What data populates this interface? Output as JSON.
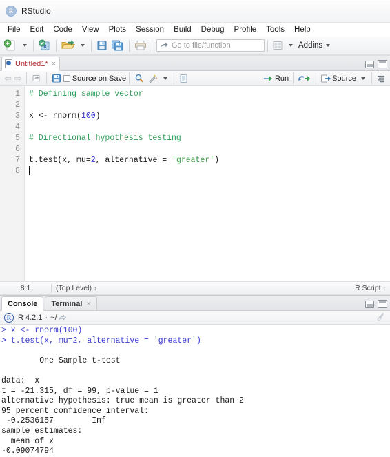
{
  "window": {
    "app_title": "RStudio",
    "logo_letter": "R"
  },
  "menubar": {
    "items": [
      {
        "label": "File"
      },
      {
        "label": "Edit"
      },
      {
        "label": "Code"
      },
      {
        "label": "View"
      },
      {
        "label": "Plots"
      },
      {
        "label": "Session"
      },
      {
        "label": "Build"
      },
      {
        "label": "Debug"
      },
      {
        "label": "Profile"
      },
      {
        "label": "Tools"
      },
      {
        "label": "Help"
      }
    ]
  },
  "toolbar": {
    "new_file_tooltip": "New File",
    "new_project_tooltip": "New Project",
    "open_file_tooltip": "Open File",
    "save_tooltip": "Save",
    "save_all_tooltip": "Save All",
    "print_tooltip": "Print",
    "goto_placeholder": "Go to file/function",
    "workspace_panes_tooltip": "Workspace Panes",
    "addins_label": "Addins"
  },
  "source_pane": {
    "tab": {
      "title": "Untitled1*",
      "close_label": "×"
    },
    "toolbar": {
      "back_label": "⇦",
      "forward_label": "⇨",
      "popout_tooltip": "Show in new window",
      "save_tooltip": "Save current document",
      "source_on_save_label": "Source on Save",
      "find_tooltip": "Find/Replace",
      "magic_tooltip": "Code Tools",
      "compile_report_tooltip": "Compile Report",
      "run_label": "Run",
      "rerun_tooltip": "Re-run previous code region",
      "source_label": "Source",
      "outline_tooltip": "Show document outline"
    },
    "code": {
      "line_numbers": [
        "1",
        "2",
        "3",
        "4",
        "5",
        "6",
        "7",
        "8"
      ],
      "lines": [
        {
          "n": 1,
          "tokens": [
            {
              "t": "# Defining sample vector",
              "c": "comment"
            }
          ]
        },
        {
          "n": 2,
          "tokens": []
        },
        {
          "n": 3,
          "tokens": [
            {
              "t": "x <- rnorm(",
              "c": "plain"
            },
            {
              "t": "100",
              "c": "num"
            },
            {
              "t": ")",
              "c": "plain"
            }
          ]
        },
        {
          "n": 4,
          "tokens": []
        },
        {
          "n": 5,
          "tokens": [
            {
              "t": "# Directional hypothesis testing",
              "c": "comment"
            }
          ]
        },
        {
          "n": 6,
          "tokens": []
        },
        {
          "n": 7,
          "tokens": [
            {
              "t": "t.test(x, mu=",
              "c": "plain"
            },
            {
              "t": "2",
              "c": "num"
            },
            {
              "t": ", alternative = ",
              "c": "plain"
            },
            {
              "t": "'greater'",
              "c": "str"
            },
            {
              "t": ")",
              "c": "plain"
            }
          ]
        },
        {
          "n": 8,
          "tokens": [],
          "caret": true
        }
      ]
    },
    "status": {
      "cursor_position": "8:1",
      "scope": "(Top Level)",
      "file_type": "R Script"
    }
  },
  "console_pane": {
    "tabs": [
      {
        "label": "Console",
        "active": true,
        "closable": false
      },
      {
        "label": "Terminal",
        "active": false,
        "closable": true,
        "close_label": "×"
      }
    ],
    "info": {
      "badge": "R",
      "version": "R 4.2.1",
      "separator": "·",
      "working_dir": "~/",
      "clear_tooltip": "Clear console"
    },
    "output": [
      {
        "text": "> x <- rnorm(100)",
        "kind": "input"
      },
      {
        "text": "> t.test(x, mu=2, alternative = 'greater')",
        "kind": "input"
      },
      {
        "text": "",
        "kind": "output"
      },
      {
        "text": "\tOne Sample t-test",
        "kind": "output"
      },
      {
        "text": "",
        "kind": "output"
      },
      {
        "text": "data:  x",
        "kind": "output"
      },
      {
        "text": "t = -21.315, df = 99, p-value = 1",
        "kind": "output"
      },
      {
        "text": "alternative hypothesis: true mean is greater than 2",
        "kind": "output"
      },
      {
        "text": "95 percent confidence interval:",
        "kind": "output"
      },
      {
        "text": " -0.2536157        Inf",
        "kind": "output"
      },
      {
        "text": "sample estimates:",
        "kind": "output"
      },
      {
        "text": "  mean of x",
        "kind": "output"
      },
      {
        "text": "-0.09074794",
        "kind": "output"
      }
    ]
  },
  "colors": {
    "comment": "#2e9b57",
    "string": "#3f9c48",
    "number": "#2f2fc8",
    "console_input": "#3b3bcc",
    "tab_modified": "#b03030"
  }
}
